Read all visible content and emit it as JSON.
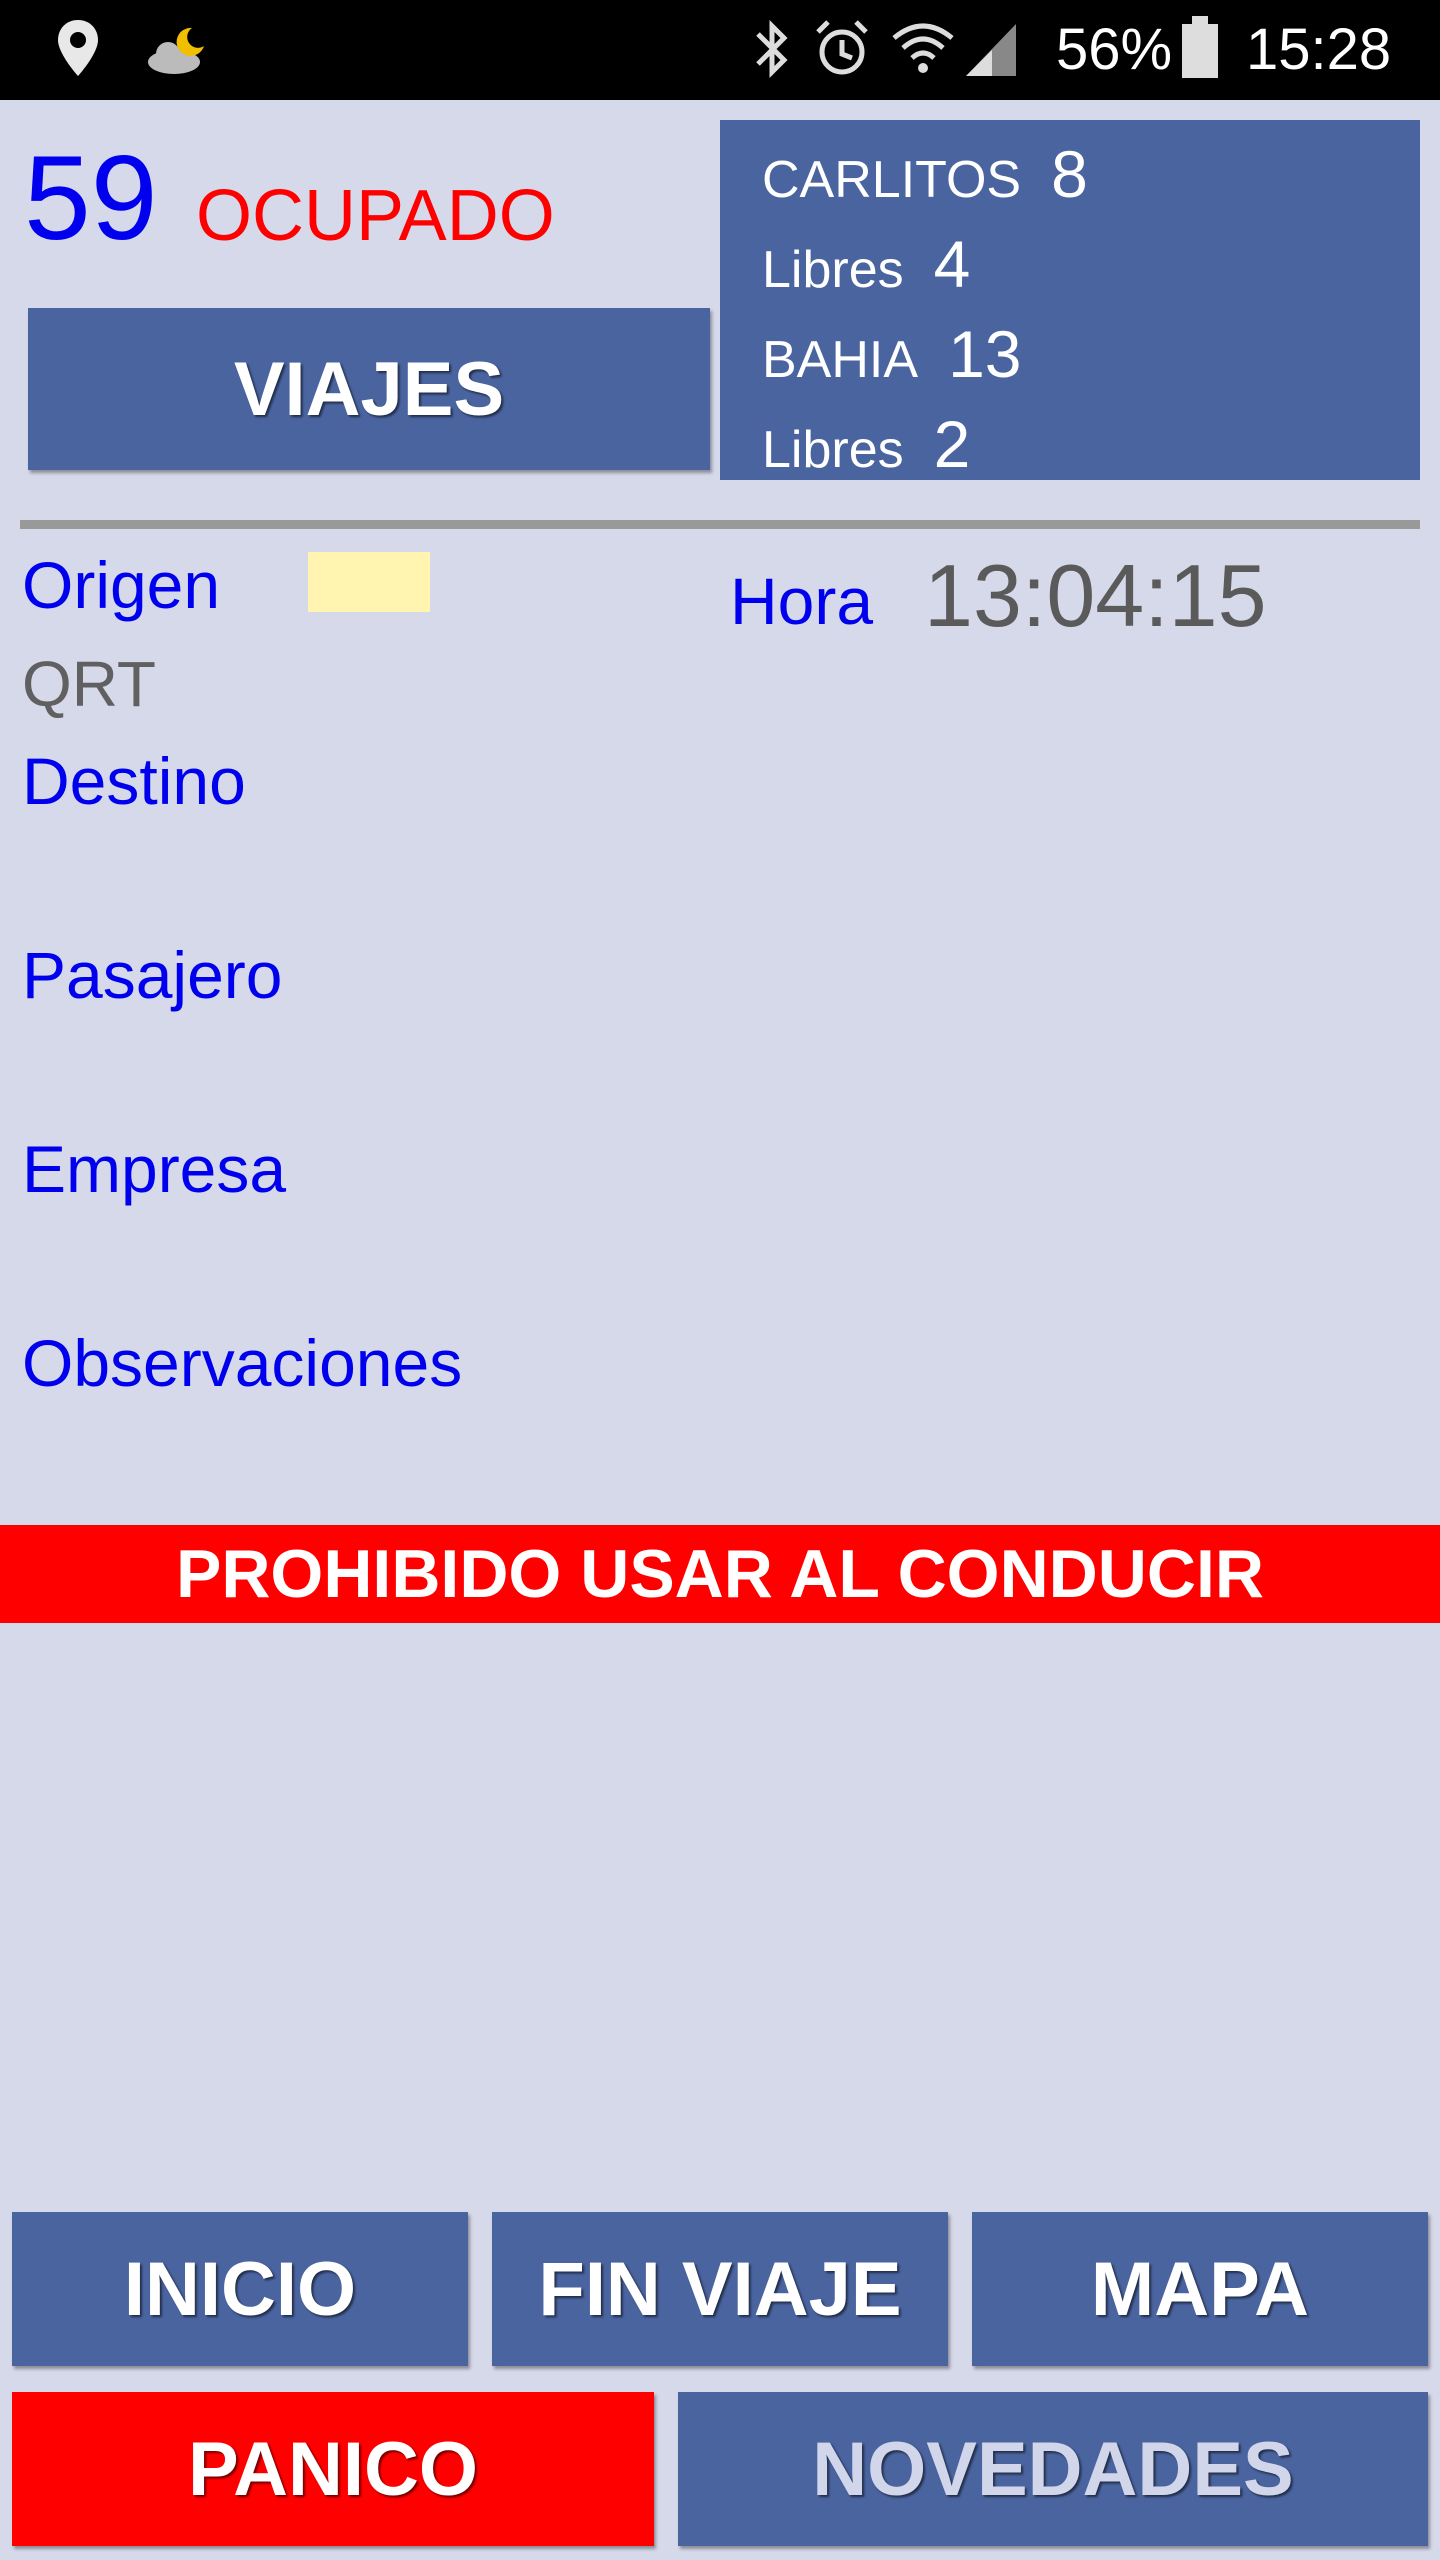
{
  "status_bar": {
    "battery": "56%",
    "time": "15:28",
    "left_icons": [
      "location-icon",
      "weather-night-icon"
    ],
    "right_icons": [
      "bluetooth-icon",
      "alarm-icon",
      "wifi-icon",
      "signal-icon",
      "battery-icon"
    ]
  },
  "unit": {
    "number": "59",
    "status": "OCUPADO"
  },
  "viajes_button": "VIAJES",
  "stops": [
    {
      "label": "CARLITOS",
      "value": "8"
    },
    {
      "label": "Libres",
      "value": "4"
    },
    {
      "label": "BAHIA",
      "value": "13"
    },
    {
      "label": "Libres",
      "value": "2"
    }
  ],
  "trip": {
    "origen_label": "Origen",
    "origen_value": "QRT",
    "hora_label": "Hora",
    "hora_value": "13:04:15",
    "destino_label": "Destino",
    "pasajero_label": "Pasajero",
    "empresa_label": "Empresa",
    "observaciones_label": "Observaciones"
  },
  "warning": "PROHIBIDO USAR AL CONDUCIR",
  "actions": {
    "inicio": "INICIO",
    "fin_viaje": "FIN VIAJE",
    "mapa": "MAPA",
    "panico": "PANICO",
    "novedades": "NOVEDADES"
  },
  "colors": {
    "background": "#d6d9ea",
    "button": "#4a64a0",
    "alert": "#ff0000",
    "label": "#0000ee"
  }
}
